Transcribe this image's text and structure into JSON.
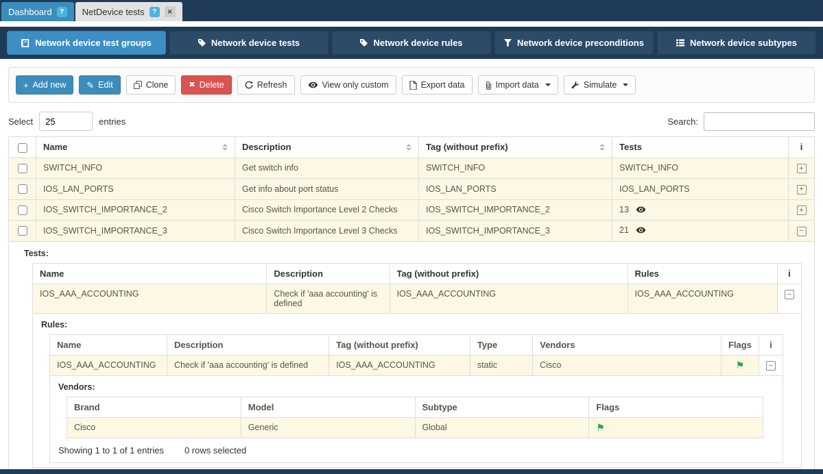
{
  "icons": {
    "help_badge": "?",
    "close": "×",
    "expand": "+",
    "collapse": "−",
    "flag": "⚑",
    "plus": "+",
    "pencil": "✎",
    "delete": "✖"
  },
  "window_tabs": [
    {
      "label": "Dashboard"
    },
    {
      "label": "NetDevice tests"
    }
  ],
  "nav_tabs": [
    {
      "label": "Network device test groups",
      "icon": "book-icon",
      "active": true
    },
    {
      "label": "Network device tests",
      "icon": "tag-icon",
      "active": false
    },
    {
      "label": "Network device rules",
      "icon": "tag-icon",
      "active": false
    },
    {
      "label": "Network device preconditions",
      "icon": "filter-icon",
      "active": false
    },
    {
      "label": "Network device subtypes",
      "icon": "list-icon",
      "active": false
    }
  ],
  "toolbar": {
    "buttons": [
      {
        "label": "Add new",
        "icon": "plus-icon",
        "style": "primary"
      },
      {
        "label": "Edit",
        "icon": "pencil-icon",
        "style": "primary"
      },
      {
        "label": "Clone",
        "icon": "clone-icon",
        "style": "default"
      },
      {
        "label": "Delete",
        "icon": "delete-icon",
        "style": "danger"
      },
      {
        "label": "Refresh",
        "icon": "refresh-icon",
        "style": "default"
      },
      {
        "label": "View only custom",
        "icon": "eye-icon",
        "style": "default"
      },
      {
        "label": "Export data",
        "icon": "file-icon",
        "style": "default"
      },
      {
        "label": "Import data",
        "icon": "paperclip-icon",
        "style": "default",
        "dropdown": true
      },
      {
        "label": "Simulate",
        "icon": "wrench-icon",
        "style": "default",
        "dropdown": true
      }
    ]
  },
  "list_controls": {
    "select_label": "Select",
    "page_size": "25",
    "entries_label": "entries",
    "search_label": "Search:"
  },
  "group_table": {
    "columns": [
      "Name",
      "Description",
      "Tag (without prefix)",
      "Tests"
    ],
    "info_column": "i",
    "rows": [
      {
        "name": "SWITCH_INFO",
        "description": "Get switch info",
        "tag": "SWITCH_INFO",
        "tests": "SWITCH_INFO"
      },
      {
        "name": "IOS_LAN_PORTS",
        "description": "Get info about port status",
        "tag": "IOS_LAN_PORTS",
        "tests": "IOS_LAN_PORTS"
      },
      {
        "name": "IOS_SWITCH_IMPORTANCE_2",
        "description": "Cisco Switch Importance Level 2 Checks",
        "tag": "IOS_SWITCH_IMPORTANCE_2",
        "tests_count": "13"
      },
      {
        "name": "IOS_SWITCH_IMPORTANCE_3",
        "description": "Cisco Switch Importance Level 3 Checks",
        "tag": "IOS_SWITCH_IMPORTANCE_3",
        "tests_count": "21"
      }
    ]
  },
  "tests_detail": {
    "label": "Tests:",
    "columns": [
      "Name",
      "Description",
      "Tag (without prefix)",
      "Rules"
    ],
    "info_column": "i",
    "rows": [
      {
        "name": "IOS_AAA_ACCOUNTING",
        "description": "Check if 'aaa accounting' is defined",
        "tag": "IOS_AAA_ACCOUNTING",
        "rules": "IOS_AAA_ACCOUNTING"
      }
    ]
  },
  "rules_detail": {
    "label": "Rules:",
    "columns": [
      "Name",
      "Description",
      "Tag (without prefix)",
      "Type",
      "Vendors",
      "Flags"
    ],
    "info_column": "i",
    "rows": [
      {
        "name": "IOS_AAA_ACCOUNTING",
        "description": "Check if 'aaa accounting' is defined",
        "tag": "IOS_AAA_ACCOUNTING",
        "type": "static",
        "vendors": "Cisco"
      }
    ]
  },
  "vendors_detail": {
    "label": "Vendors:",
    "columns": [
      "Brand",
      "Model",
      "Subtype",
      "Flags"
    ],
    "rows": [
      {
        "brand": "Cisco",
        "model": "Generic",
        "subtype": "Global"
      }
    ]
  },
  "table_footer": {
    "showing_text": "Showing 1 to 1 of 1 entries",
    "selected_text": "0 rows selected"
  },
  "colors": {
    "header_navy": "#1f3b57",
    "nav_button": "#2d4a68",
    "primary_blue": "#3c8dbc",
    "active_nav_blue": "#3e8ec6",
    "danger_red": "#d9534f",
    "row_cream": "#fcf8e3",
    "flag_green": "#2fa055",
    "info_badge_blue": "#4cb2e0"
  }
}
